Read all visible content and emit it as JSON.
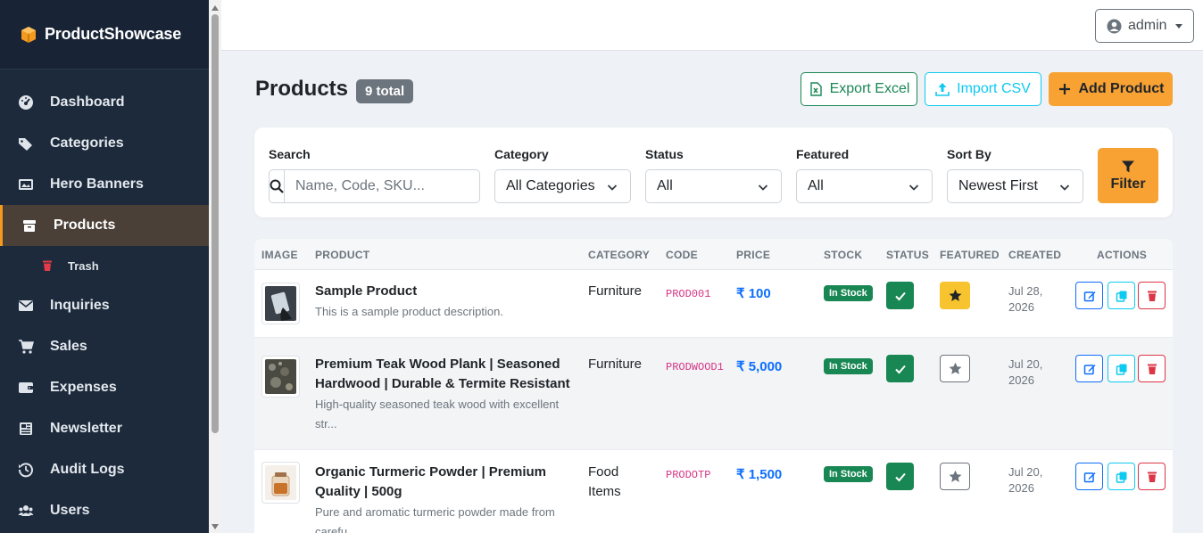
{
  "app": {
    "brand": "ProductShowcase"
  },
  "sidebar": {
    "items": [
      {
        "label": "Dashboard",
        "icon": "dashboard-icon"
      },
      {
        "label": "Categories",
        "icon": "tags-icon"
      },
      {
        "label": "Hero Banners",
        "icon": "images-icon"
      },
      {
        "label": "Products",
        "icon": "box-icon",
        "active": true
      },
      {
        "label": "Trash",
        "icon": "trash-icon",
        "sub": true
      },
      {
        "label": "Inquiries",
        "icon": "envelope-icon"
      },
      {
        "label": "Sales",
        "icon": "cart-icon"
      },
      {
        "label": "Expenses",
        "icon": "wallet-icon"
      },
      {
        "label": "Newsletter",
        "icon": "newspaper-icon"
      },
      {
        "label": "Audit Logs",
        "icon": "history-icon"
      },
      {
        "label": "Users",
        "icon": "users-icon"
      }
    ]
  },
  "topbar": {
    "user": "admin"
  },
  "header": {
    "title": "Products",
    "total_badge": "9 total",
    "export_label": "Export Excel",
    "import_label": "Import CSV",
    "add_label": "Add Product"
  },
  "filters": {
    "search_label": "Search",
    "search_placeholder": "Name, Code, SKU...",
    "category_label": "Category",
    "category_value": "All Categories",
    "status_label": "Status",
    "status_value": "All",
    "featured_label": "Featured",
    "featured_value": "All",
    "sort_label": "Sort By",
    "sort_value": "Newest First",
    "filter_button": "Filter"
  },
  "table": {
    "columns": [
      "IMAGE",
      "PRODUCT",
      "CATEGORY",
      "CODE",
      "PRICE",
      "STOCK",
      "STATUS",
      "FEATURED",
      "CREATED",
      "ACTIONS"
    ],
    "rows": [
      {
        "name_line1": "Sample Product",
        "name_line2": "",
        "desc_line1": "This is a sample product description.",
        "desc_line2": "",
        "category_line1": "Furniture",
        "category_line2": "",
        "code": "PROD001",
        "price": "₹ 100",
        "stock": "In Stock",
        "status_active": true,
        "featured": true,
        "date_line1": "Jul 28,",
        "date_line2": "2026"
      },
      {
        "name_line1": "Premium Teak Wood Plank | Seasoned",
        "name_line2": "Hardwood | Durable & Termite Resistant",
        "desc_line1": "High-quality seasoned teak wood with excellent",
        "desc_line2": "str...",
        "category_line1": "Furniture",
        "category_line2": "",
        "code": "PRODWOOD1",
        "price": "₹ 5,000",
        "stock": "In Stock",
        "status_active": true,
        "featured": false,
        "date_line1": "Jul 20,",
        "date_line2": "2026"
      },
      {
        "name_line1": "Organic Turmeric Powder | Premium",
        "name_line2": "Quality | 500g",
        "desc_line1": "Pure and aromatic turmeric powder made from",
        "desc_line2": "carefu...",
        "category_line1": "Food",
        "category_line2": "Items",
        "code": "PRODOTP",
        "price": "₹ 1,500",
        "stock": "In Stock",
        "status_active": true,
        "featured": false,
        "date_line1": "Jul 20,",
        "date_line2": "2026"
      }
    ]
  },
  "colors": {
    "sidebar_bg": "#1d2a3b",
    "accent": "#f7a233",
    "success": "#198754",
    "info": "#0dcaf0",
    "primary": "#0d6efd",
    "danger": "#dc3545"
  }
}
